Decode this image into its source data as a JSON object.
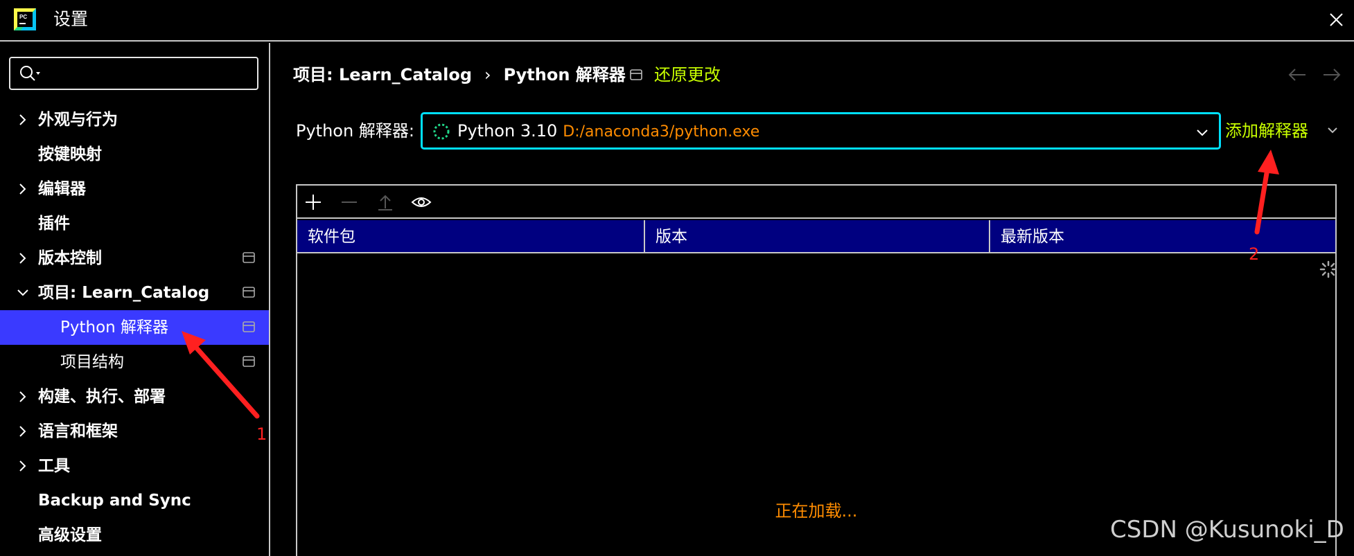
{
  "window": {
    "title": "设置",
    "close_icon": "close-icon"
  },
  "search": {
    "placeholder": "",
    "value": ""
  },
  "sidebar": {
    "items": [
      {
        "label": "外观与行为",
        "expand": "collapsed",
        "child": false,
        "project_icon": false
      },
      {
        "label": "按键映射",
        "expand": "none",
        "child": false,
        "project_icon": false
      },
      {
        "label": "编辑器",
        "expand": "collapsed",
        "child": false,
        "project_icon": false
      },
      {
        "label": "插件",
        "expand": "none",
        "child": false,
        "project_icon": false
      },
      {
        "label": "版本控制",
        "expand": "collapsed",
        "child": false,
        "project_icon": true
      },
      {
        "label": "项目: Learn_Catalog",
        "expand": "expanded",
        "child": false,
        "project_icon": true
      },
      {
        "label": "Python 解释器",
        "expand": "none",
        "child": true,
        "project_icon": true,
        "selected": true
      },
      {
        "label": "项目结构",
        "expand": "none",
        "child": true,
        "project_icon": true
      },
      {
        "label": "构建、执行、部署",
        "expand": "collapsed",
        "child": false,
        "project_icon": false
      },
      {
        "label": "语言和框架",
        "expand": "collapsed",
        "child": false,
        "project_icon": false
      },
      {
        "label": "工具",
        "expand": "collapsed",
        "child": false,
        "project_icon": false
      },
      {
        "label": "Backup and Sync",
        "expand": "none",
        "child": false,
        "project_icon": false
      },
      {
        "label": "高级设置",
        "expand": "none",
        "child": false,
        "project_icon": false
      }
    ]
  },
  "breadcrumb": {
    "project": "项目: Learn_Catalog",
    "separator": "›",
    "page": "Python 解释器"
  },
  "reset": {
    "label": "还原更改"
  },
  "interpreter": {
    "label": "Python 解释器:",
    "name": "Python 3.10",
    "path": "D:/anaconda3/python.exe",
    "add_label": "添加解释器"
  },
  "packages": {
    "columns": [
      "软件包",
      "版本",
      "最新版本"
    ],
    "loading_text": "正在加载..."
  },
  "annotations": {
    "arrow1_label": "1",
    "arrow2_label": "2"
  },
  "watermark": "CSDN @Kusunoki_D",
  "colors": {
    "accent_selected": "#3a3aff",
    "link": "#c8ff00",
    "header_bg": "#000080",
    "focus_border": "#00e0ff",
    "path_orange": "#ff8c00",
    "annotation_red": "#ff2020"
  }
}
